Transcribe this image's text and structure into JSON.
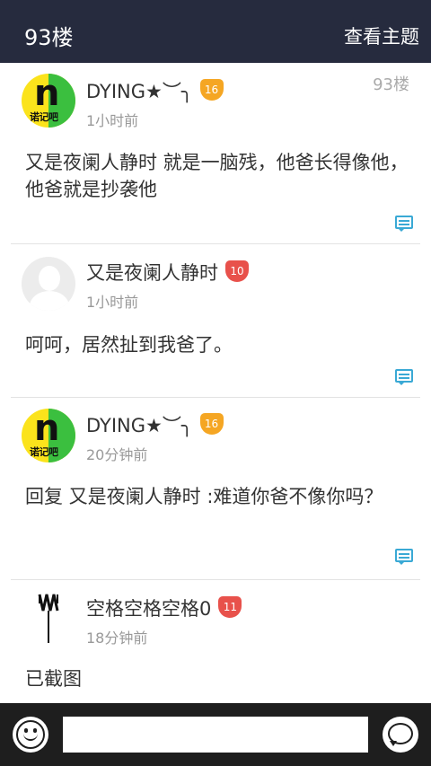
{
  "header": {
    "title": "93楼",
    "action_label": "查看主题"
  },
  "posts": [
    {
      "avatar": {
        "type": "logo",
        "letter": "n",
        "caption": "诺记吧"
      },
      "username": "DYING★︶╮",
      "level": "16",
      "time": "1小时前",
      "floor": "93楼",
      "text": "又是夜阑人静时 就是一脑残，他爸长得像他，他爸就是抄袭他"
    },
    {
      "avatar": {
        "type": "default"
      },
      "username": "又是夜阑人静时",
      "level": "10",
      "time": "1小时前",
      "text": "呵呵，居然扯到我爸了。"
    },
    {
      "avatar": {
        "type": "logo",
        "letter": "n",
        "caption": "诺记吧"
      },
      "username": "DYING★︶╮",
      "level": "16",
      "time": "20分钟前",
      "text": "回复 又是夜阑人静时 :难道你爸不像你吗？"
    },
    {
      "avatar": {
        "type": "mm-logo"
      },
      "username": "空格空格空格0",
      "level": "11",
      "time": "18分钟前",
      "text": "已截图"
    }
  ],
  "bottombar": {
    "input_placeholder": "",
    "emoji_icon": "emoji-icon",
    "send_icon": "chat-send-icon"
  },
  "colors": {
    "header_bg": "#262b3e",
    "accent": "#3aa9d5",
    "badge_gold": "#f5a623",
    "badge_red": "#e8514b"
  }
}
